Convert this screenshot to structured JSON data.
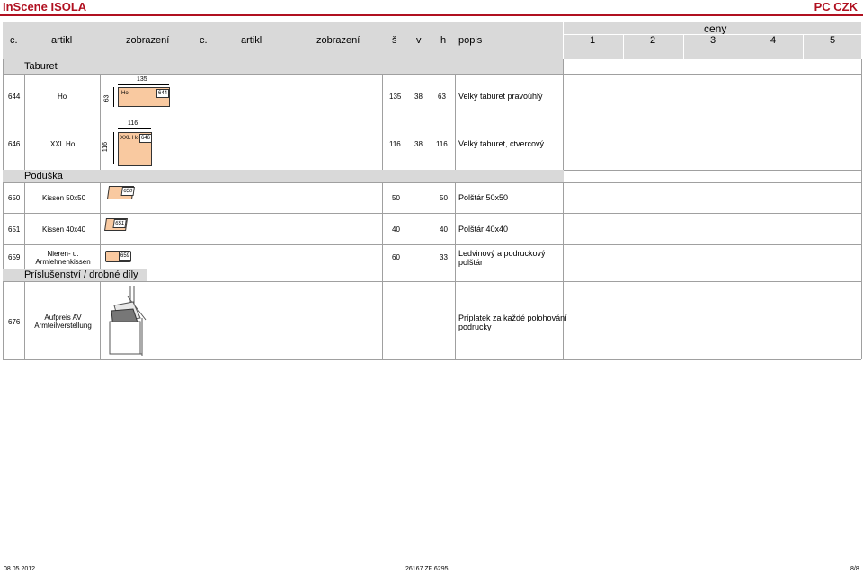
{
  "app": {
    "title": "InScene ISOLA",
    "right_title": "PC CZK"
  },
  "header": {
    "col_c1": "c.",
    "col_artikl1": "artikl",
    "col_zobrazeni1": "zobrazení",
    "col_c2": "c.",
    "col_artikl2": "artikl",
    "col_zobrazeni2": "zobrazení",
    "col_s": "š",
    "col_v": "v",
    "col_h": "h",
    "col_popis": "popis",
    "prices_label": "ceny",
    "price_cols": [
      "1",
      "2",
      "3",
      "4",
      "5"
    ]
  },
  "sections": {
    "taburet": "Taburet",
    "poduska": "Poduška",
    "prislusenstvi": "Príslušenství / drobné díly"
  },
  "rows": [
    {
      "no": "644",
      "artikl": "Ho",
      "s": "135",
      "v": "38",
      "h": "63",
      "popis": "Velký taburet pravoúhlý",
      "box_label": "Ho",
      "tag": "644",
      "dim_top": "135",
      "dim_side": "63"
    },
    {
      "no": "646",
      "artikl": "XXL Ho",
      "s": "116",
      "v": "38",
      "h": "116",
      "popis": "Velký taburet, ctvercový",
      "box_label": "XXL Ho",
      "tag": "646",
      "dim_top": "116",
      "dim_side": "116"
    },
    {
      "no": "650",
      "artikl": "Kissen 50x50",
      "s": "50",
      "v": "",
      "h": "50",
      "popis": "Polštár 50x50",
      "tag": "650"
    },
    {
      "no": "651",
      "artikl": "Kissen 40x40",
      "s": "40",
      "v": "",
      "h": "40",
      "popis": "Polštár 40x40",
      "tag": "651"
    },
    {
      "no": "659",
      "artikl_l1": "Nieren- u.",
      "artikl_l2": "Armlehnenkissen",
      "s": "60",
      "v": "",
      "h": "33",
      "popis_l1": "Ledvinový a podruckový",
      "popis_l2": "polštár",
      "tag": "659"
    },
    {
      "no": "676",
      "artikl_l1": "Aufpreis AV",
      "artikl_l2": "Armteilverstellung",
      "popis_l1": "Príplatek za každé polohování",
      "popis_l2": "podrucky"
    }
  ],
  "footer": {
    "date": "08.05.2012",
    "code": "26167 ZF 6295",
    "page": "8/8"
  },
  "colors": {
    "brand": "#b01020",
    "header_bg": "#d9d9d9",
    "box_fill": "#f9c9a0"
  }
}
